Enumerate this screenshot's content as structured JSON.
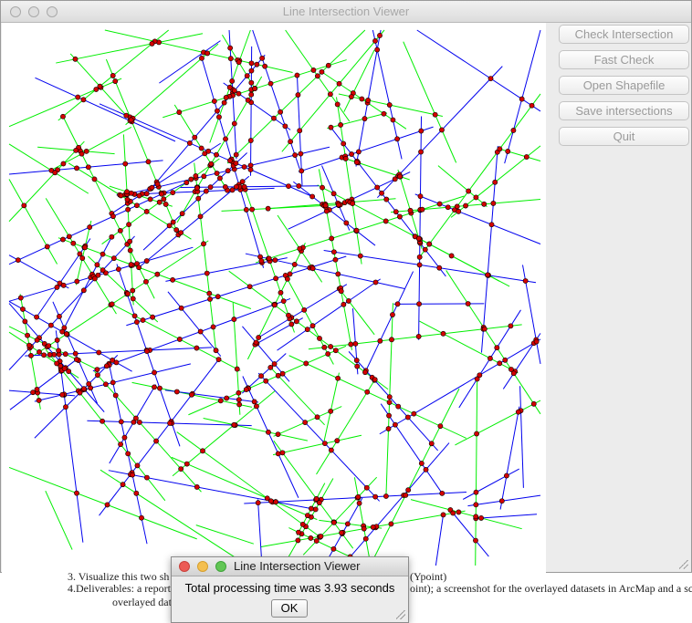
{
  "window": {
    "title": "Line Intersection Viewer"
  },
  "buttons": {
    "check_intersection": "Check Intersection",
    "fast_check": "Fast Check",
    "open_shapefile": "Open Shapefile",
    "save_intersections": "Save intersections",
    "quit": "Quit"
  },
  "colors": {
    "layer_a": "#0000ee",
    "layer_b": "#00ee00",
    "intersection_fill": "#d40000",
    "intersection_stroke": "#000000"
  },
  "dialog": {
    "title": "Line Intersection Viewer",
    "message": "Total processing time was 3.93 seconds",
    "ok_label": "OK"
  },
  "background_document": {
    "line1": "3. Visualize this two sh",
    "line1_right": "(Ypoint)",
    "line2": "4.Deliverables: a report",
    "line2_right": "oint); a screenshot for the overlayed datasets in ArcMap and a scr",
    "line3": "overlayed data"
  }
}
